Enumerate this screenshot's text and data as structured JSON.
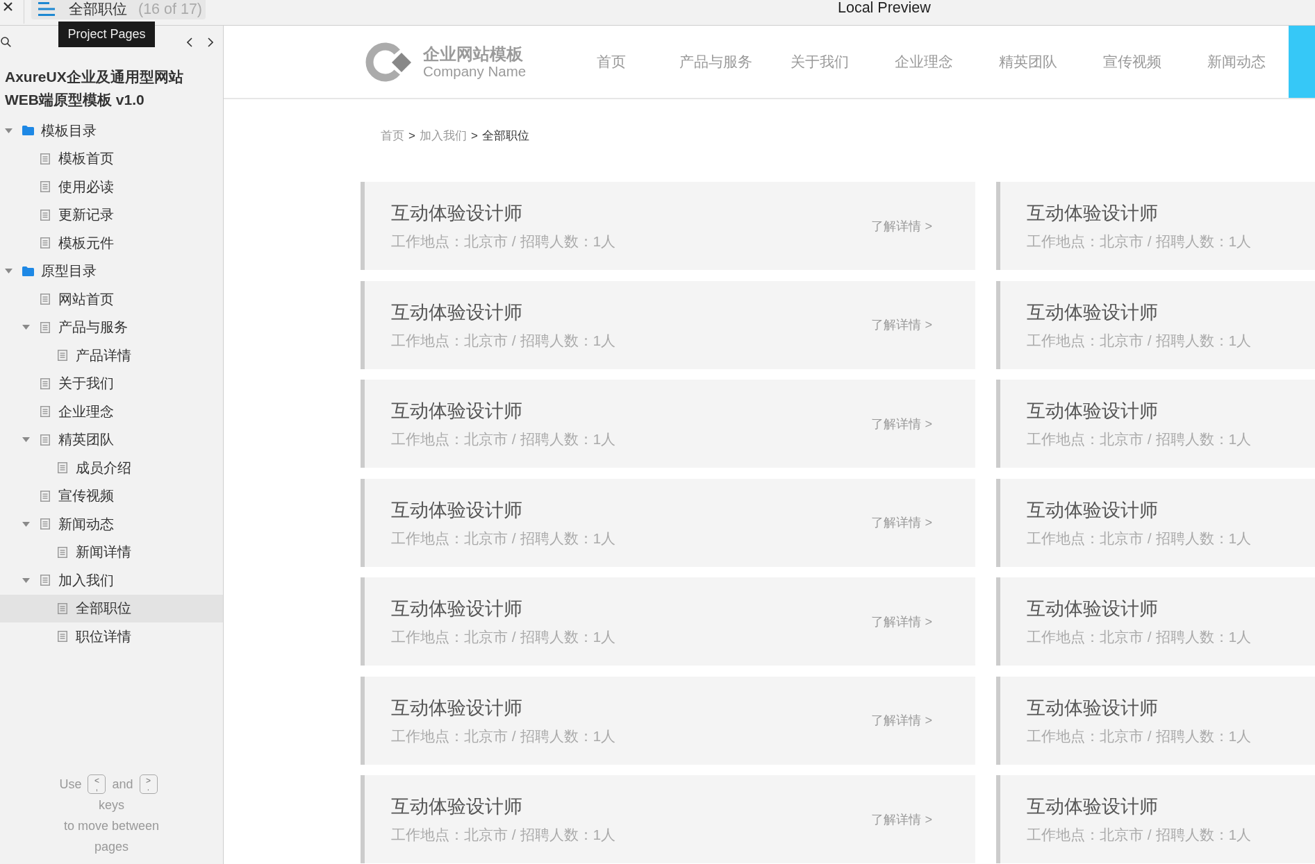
{
  "top_bar": {
    "page_title": "全部职位",
    "page_count": "(16 of 17)",
    "tooltip": "Project Pages",
    "preview_title": "Local Preview"
  },
  "sidebar": {
    "title_lines": [
      "AxureUX企业及通用型网站",
      "WEB端原型模板 v1.0"
    ],
    "tree": [
      {
        "label": "模板目录",
        "kind": "folder",
        "selected": false,
        "expanded": true,
        "children": [
          {
            "label": "模板首页",
            "kind": "page",
            "selected": false
          },
          {
            "label": "使用必读",
            "kind": "page",
            "selected": false
          },
          {
            "label": "更新记录",
            "kind": "page",
            "selected": false
          },
          {
            "label": "模板元件",
            "kind": "page",
            "selected": false
          }
        ]
      },
      {
        "label": "原型目录",
        "kind": "folder",
        "selected": false,
        "expanded": true,
        "children": [
          {
            "label": "网站首页",
            "kind": "page",
            "selected": false
          },
          {
            "label": "产品与服务",
            "kind": "page",
            "selected": false,
            "expanded": true,
            "children": [
              {
                "label": "产品详情",
                "kind": "page",
                "selected": false
              }
            ]
          },
          {
            "label": "关于我们",
            "kind": "page",
            "selected": false
          },
          {
            "label": "企业理念",
            "kind": "page",
            "selected": false
          },
          {
            "label": "精英团队",
            "kind": "page",
            "selected": false,
            "expanded": true,
            "children": [
              {
                "label": "成员介绍",
                "kind": "page",
                "selected": false
              }
            ]
          },
          {
            "label": "宣传视频",
            "kind": "page",
            "selected": false
          },
          {
            "label": "新闻动态",
            "kind": "page",
            "selected": false,
            "expanded": true,
            "children": [
              {
                "label": "新闻详情",
                "kind": "page",
                "selected": false
              }
            ]
          },
          {
            "label": "加入我们",
            "kind": "page",
            "selected": false,
            "expanded": true,
            "children": [
              {
                "label": "全部职位",
                "kind": "page",
                "selected": true
              },
              {
                "label": "职位详情",
                "kind": "page",
                "selected": false
              }
            ]
          }
        ]
      }
    ],
    "hint": {
      "before": "Use",
      "key_1": {
        "upper": "<",
        "lower": ","
      },
      "between": "and",
      "key_2": {
        "upper": ">",
        "lower": "."
      },
      "after_lines": [
        "keys",
        "to move between",
        "pages"
      ]
    }
  },
  "header": {
    "logo": {
      "title": "企业网站模板",
      "subtitle": "Company Name"
    },
    "nav": [
      {
        "label": "首页",
        "selected": false
      },
      {
        "label": "产品与服务",
        "selected": false
      },
      {
        "label": "关于我们",
        "selected": false
      },
      {
        "label": "企业理念",
        "selected": false
      },
      {
        "label": "精英团队",
        "selected": false
      },
      {
        "label": "宣传视频",
        "selected": false
      },
      {
        "label": "新闻动态",
        "selected": false
      },
      {
        "selected": true
      }
    ]
  },
  "breadcrumb": [
    {
      "kind": "link",
      "label": "首页"
    },
    {
      "kind": "separator",
      "label": ">"
    },
    {
      "kind": "link",
      "label": "加入我们"
    },
    {
      "kind": "separator",
      "label": ">"
    },
    {
      "kind": "current",
      "label": "全部职位"
    }
  ],
  "jobs": [
    {
      "title": "互动体验设计师",
      "meta": "工作地点：北京市 / 招聘人数：1人",
      "link": "了解详情 >"
    },
    {
      "title": "互动体验设计师",
      "meta": "工作地点：北京市 / 招聘人数：1人"
    },
    {
      "title": "互动体验设计师",
      "meta": "工作地点：北京市 / 招聘人数：1人",
      "link": "了解详情 >"
    },
    {
      "title": "互动体验设计师",
      "meta": "工作地点：北京市 / 招聘人数：1人"
    },
    {
      "title": "互动体验设计师",
      "meta": "工作地点：北京市 / 招聘人数：1人",
      "link": "了解详情 >"
    },
    {
      "title": "互动体验设计师",
      "meta": "工作地点：北京市 / 招聘人数：1人"
    },
    {
      "title": "互动体验设计师",
      "meta": "工作地点：北京市 / 招聘人数：1人",
      "link": "了解详情 >"
    },
    {
      "title": "互动体验设计师",
      "meta": "工作地点：北京市 / 招聘人数：1人"
    },
    {
      "title": "互动体验设计师",
      "meta": "工作地点：北京市 / 招聘人数：1人",
      "link": "了解详情 >"
    },
    {
      "title": "互动体验设计师",
      "meta": "工作地点：北京市 / 招聘人数：1人"
    },
    {
      "title": "互动体验设计师",
      "meta": "工作地点：北京市 / 招聘人数：1人",
      "link": "了解详情 >"
    },
    {
      "title": "互动体验设计师",
      "meta": "工作地点：北京市 / 招聘人数：1人"
    },
    {
      "title": "互动体验设计师",
      "meta": "工作地点：北京市 / 招聘人数：1人",
      "link": "了解详情 >"
    },
    {
      "title": "互动体验设计师",
      "meta": "工作地点：北京市 / 招聘人数：1人"
    }
  ]
}
